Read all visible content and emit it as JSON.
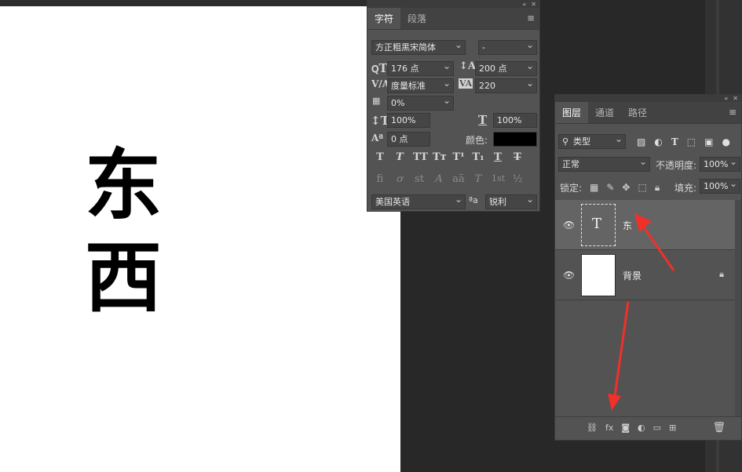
{
  "canvas": {
    "text_lines": [
      "东",
      "西"
    ]
  },
  "character_panel": {
    "tabs": [
      "字符",
      "段落"
    ],
    "font_family": "方正粗黑宋简体",
    "font_style": "-",
    "font_size": "176 点",
    "leading": "200 点",
    "kerning": "度量标准",
    "tracking": "220",
    "tsume": "0%",
    "vertical_scale": "100%",
    "horizontal_scale": "100%",
    "baseline_shift": "0 点",
    "color_label": "颜色:",
    "text_color": "#000000",
    "style_buttons": [
      "T",
      "T",
      "TT",
      "Tт",
      "T¹",
      "T₁",
      "T",
      "T"
    ],
    "opentype_buttons": [
      "fi",
      "ơ",
      "st",
      "A",
      "aā",
      "T",
      "1st",
      "½"
    ],
    "language": "美国英语",
    "aa_label": "ªa",
    "antialias": "锐利"
  },
  "layers_panel": {
    "tabs": [
      "图层",
      "通道",
      "路径"
    ],
    "filter_kind": "类型",
    "blend_mode": "正常",
    "opacity_label": "不透明度:",
    "opacity": "100%",
    "lock_label": "锁定:",
    "fill_label": "填充:",
    "fill": "100%",
    "layers": [
      {
        "name": "东",
        "type": "text",
        "thumb_glyph": "T",
        "selected": true,
        "locked": false
      },
      {
        "name": "背景",
        "type": "image",
        "thumb_glyph": "",
        "selected": false,
        "locked": true
      }
    ],
    "bottom_icons": [
      "link-icon",
      "fx-icon",
      "mask-icon",
      "adjustment-icon",
      "group-icon",
      "new-layer-icon",
      "trash-icon"
    ]
  },
  "colors": {
    "panel_bg": "#535353",
    "workspace_bg": "#282828",
    "selected_layer": "#646464",
    "arrow_red": "#f0302a"
  }
}
